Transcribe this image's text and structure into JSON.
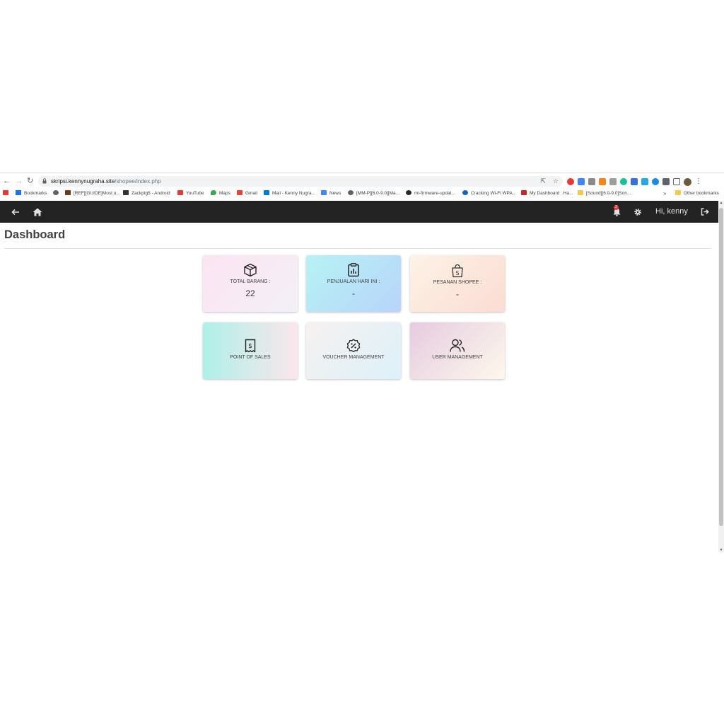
{
  "browser": {
    "url_host": "skripsi.kennynugraha.site",
    "url_path": "/shopee/index.php",
    "bookmarks": [
      "Bookmarks",
      "[REF][GUIDE]Most u...",
      "Zackptg5 - Android",
      "YouTube",
      "Maps",
      "Gmail",
      "Mail - Kenny Nugra...",
      "News",
      "[MM-P][6.0-9.0][Ma...",
      "mi-firmware-updat...",
      "Cracking Wi-Fi WPA...",
      "My Dashboard : Ha...",
      "[Sound][6.0-9.0]Son..."
    ],
    "bookmarks_more": "»",
    "other_bookmarks": "Other bookmarks"
  },
  "navbar": {
    "greeting": "Hi, kenny",
    "notification_count": "2"
  },
  "page": {
    "title": "Dashboard"
  },
  "cards": [
    {
      "label": "TOTAL BARANG :",
      "value": "22",
      "icon": "box-icon"
    },
    {
      "label": "PENJUALAN HARI INI :",
      "value": "-",
      "icon": "clipboard-chart-icon"
    },
    {
      "label": "PESANAN SHOPEE :",
      "value": "-",
      "icon": "shopping-bag-icon"
    },
    {
      "label": "POINT OF SALES",
      "icon": "receipt-icon"
    },
    {
      "label": "VOUCHER MANAGEMENT",
      "icon": "discount-badge-icon"
    },
    {
      "label": "USER MANAGEMENT",
      "icon": "users-icon"
    }
  ],
  "colors": {
    "navbar_bg": "#232323",
    "card_total_barang": [
      "#fce4f3",
      "#f3f0f6"
    ],
    "card_penjualan": [
      "#b6f3f3",
      "#b8d4fb"
    ],
    "card_pesanan": [
      "#fdf2e6",
      "#fcdcd3"
    ],
    "card_pos": [
      "#aef0e8",
      "#fce6ec"
    ],
    "card_voucher": [
      "#f7f1ef",
      "#dcf1fa"
    ],
    "card_user": [
      "#e6cbe0",
      "#fdf8ec"
    ]
  }
}
